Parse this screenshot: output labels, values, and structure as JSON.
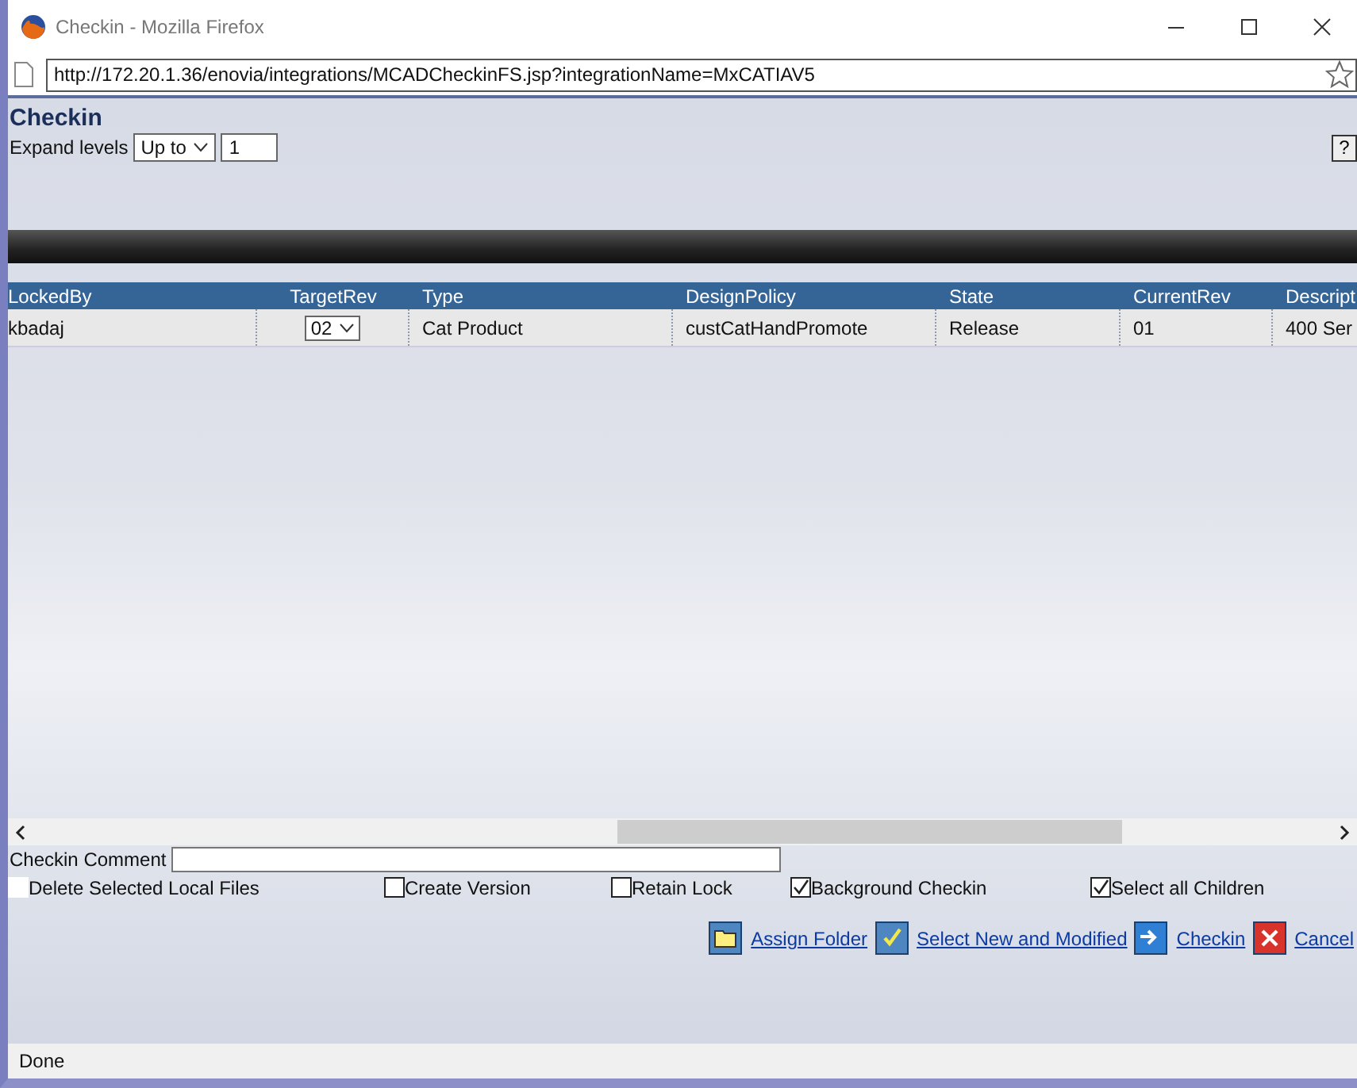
{
  "window": {
    "title": "Checkin - Mozilla Firefox"
  },
  "address_bar": {
    "value": "http://172.20.1.36/enovia/integrations/MCADCheckinFS.jsp?integrationName=MxCATIAV5"
  },
  "page": {
    "title": "Checkin",
    "expand_label": "Expand levels",
    "expand_mode": "Up to",
    "expand_value": "1",
    "help": "?"
  },
  "table": {
    "columns": [
      "LockedBy",
      "TargetRev",
      "Type",
      "DesignPolicy",
      "State",
      "CurrentRev",
      "Descript"
    ],
    "rows": [
      {
        "cells": [
          "kbadaj",
          "02",
          "Cat Product",
          "custCatHandPromote",
          "Release",
          "01",
          "400 Ser"
        ]
      }
    ]
  },
  "comment": {
    "label": "Checkin Comment"
  },
  "options": [
    {
      "label": "Delete Selected Local Files",
      "checked": false
    },
    {
      "label": "Create Version",
      "checked": false
    },
    {
      "label": "Retain Lock",
      "checked": false
    },
    {
      "label": "Background Checkin",
      "checked": true
    },
    {
      "label": "Select all Children",
      "checked": true
    }
  ],
  "actions": [
    {
      "label": "Assign Folder",
      "kind": "folder"
    },
    {
      "label": "Select New and Modified",
      "kind": "tick"
    },
    {
      "label": "Checkin",
      "kind": "arrow"
    },
    {
      "label": "Cancel",
      "kind": "cancel"
    }
  ],
  "status_bar": "Done"
}
